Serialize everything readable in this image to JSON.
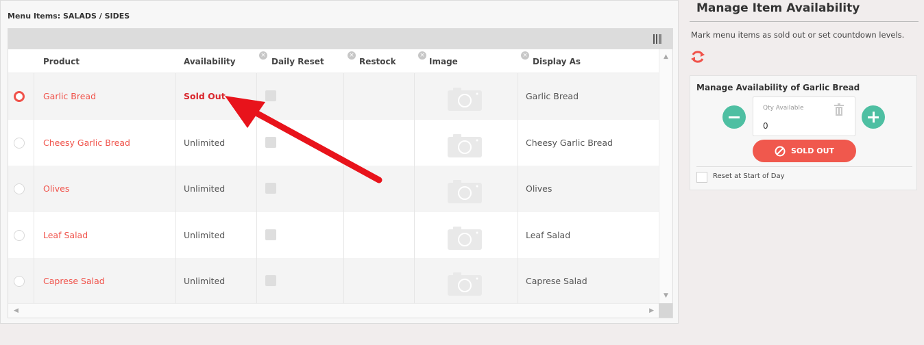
{
  "menu_title": "Menu Items: SALADS / SIDES",
  "columns": {
    "product": "Product",
    "availability": "Availability",
    "daily_reset": "Daily Reset",
    "restock": "Restock",
    "image": "Image",
    "display_as": "Display As"
  },
  "rows": [
    {
      "product": "Garlic Bread",
      "availability": "Sold Out",
      "display_as": "Garlic Bread",
      "selected": true
    },
    {
      "product": "Cheesy Garlic Bread",
      "availability": "Unlimited",
      "display_as": "Cheesy Garlic Bread",
      "selected": false
    },
    {
      "product": "Olives",
      "availability": "Unlimited",
      "display_as": "Olives",
      "selected": false
    },
    {
      "product": "Leaf Salad",
      "availability": "Unlimited",
      "display_as": "Leaf Salad",
      "selected": false
    },
    {
      "product": "Caprese Salad",
      "availability": "Unlimited",
      "display_as": "Caprese Salad",
      "selected": false
    }
  ],
  "panel": {
    "title": "Manage Item Availability",
    "description": "Mark menu items as sold out or set countdown levels.",
    "card_title": "Manage Availability of Garlic Bread",
    "qty_label": "Qty Available",
    "qty_value": "0",
    "sold_out_label": "SOLD OUT",
    "reset_label": "Reset at Start of Day"
  },
  "colors": {
    "accent": "#f0524a",
    "sold_out_text": "#d9262c",
    "stepper": "#4ebfa2",
    "annotation_arrow": "#e8131b"
  },
  "icons": [
    "column-chooser-icon",
    "clear-filter-icon",
    "camera-icon",
    "refresh-icon",
    "minus-icon",
    "plus-icon",
    "trash-icon",
    "ban-icon"
  ]
}
